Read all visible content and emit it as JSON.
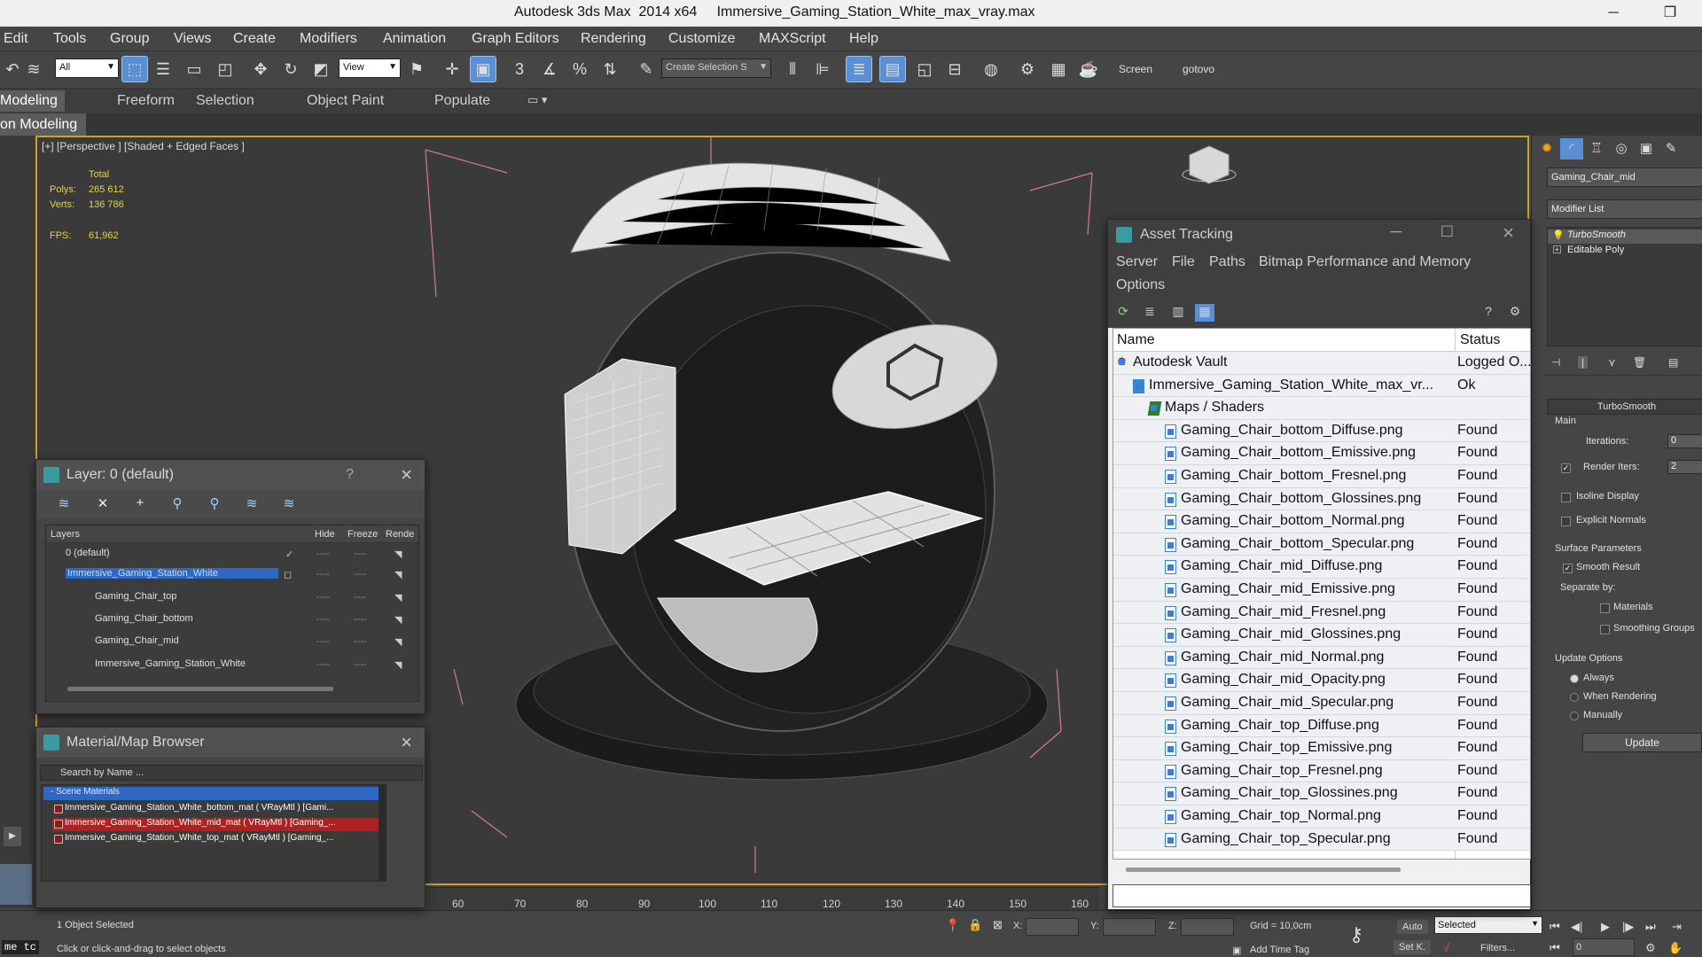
{
  "window": {
    "title": "Autodesk 3ds Max  2014 x64     Immersive_Gaming_Station_White_max_vray.max",
    "minimize": "─",
    "maximize": "❐"
  },
  "menu": [
    "Edit",
    "Tools",
    "Group",
    "Views",
    "Create",
    "Modifiers",
    "Animation",
    "Graph Editors",
    "Rendering",
    "Customize",
    "MAXScript",
    "Help"
  ],
  "toolbar": {
    "filter_value": "All",
    "view_value": "View",
    "selection_set_placeholder": "Create Selection S",
    "screen_label": "Screen",
    "gotovo_label": "gotovo"
  },
  "ribbon": {
    "tabs": [
      "Modeling",
      "Freeform",
      "Selection",
      "Object Paint",
      "Populate"
    ],
    "sub_label": "on Modeling"
  },
  "viewport": {
    "label": "[+] [Perspective ] [Shaded + Edged Faces ]",
    "stats_total": "Total",
    "polys_label": "Polys:",
    "polys_value": "265 612",
    "verts_label": "Verts:",
    "verts_value": "136 786",
    "fps_label": "FPS:",
    "fps_value": "61,962"
  },
  "layer_explorer": {
    "title": "Layer: 0 (default)",
    "help": "?",
    "columns": [
      "Layers",
      "Hide",
      "Freeze",
      "Rende"
    ],
    "rows": [
      {
        "name": "0 (default)",
        "indent": 0
      },
      {
        "name": "Immersive_Gaming_Station_White",
        "indent": 0,
        "selected": true
      },
      {
        "name": "Gaming_Chair_top",
        "indent": 1
      },
      {
        "name": "Gaming_Chair_bottom",
        "indent": 1
      },
      {
        "name": "Gaming_Chair_mid",
        "indent": 1
      },
      {
        "name": "Immersive_Gaming_Station_White",
        "indent": 1
      }
    ],
    "dash": "----"
  },
  "material_browser": {
    "title": "Material/Map Browser",
    "search_placeholder": "Search by Name ...",
    "group": "- Scene Materials",
    "items": [
      "Immersive_Gaming_Station_White_bottom_mat ( VRayMtl ) [Gami...",
      "Immersive_Gaming_Station_White_mid_mat ( VRayMtl ) [Gaming_...",
      "Immersive_Gaming_Station_White_top_mat ( VRayMtl ) [Gaming_..."
    ]
  },
  "asset_tracking": {
    "title": "Asset Tracking",
    "menu": [
      "Server",
      "File",
      "Paths",
      "Bitmap Performance and Memory",
      "Options"
    ],
    "col_name": "Name",
    "col_status": "Status",
    "rows": [
      {
        "name": "Autodesk Vault",
        "status": "Logged O...",
        "level": 0
      },
      {
        "name": "Immersive_Gaming_Station_White_max_vr...",
        "status": "Ok",
        "level": 1
      },
      {
        "name": "Maps / Shaders",
        "status": "",
        "level": 2
      },
      {
        "name": "Gaming_Chair_bottom_Diffuse.png",
        "status": "Found",
        "level": 3
      },
      {
        "name": "Gaming_Chair_bottom_Emissive.png",
        "status": "Found",
        "level": 3
      },
      {
        "name": "Gaming_Chair_bottom_Fresnel.png",
        "status": "Found",
        "level": 3
      },
      {
        "name": "Gaming_Chair_bottom_Glossines.png",
        "status": "Found",
        "level": 3
      },
      {
        "name": "Gaming_Chair_bottom_Normal.png",
        "status": "Found",
        "level": 3
      },
      {
        "name": "Gaming_Chair_bottom_Specular.png",
        "status": "Found",
        "level": 3
      },
      {
        "name": "Gaming_Chair_mid_Diffuse.png",
        "status": "Found",
        "level": 3
      },
      {
        "name": "Gaming_Chair_mid_Emissive.png",
        "status": "Found",
        "level": 3
      },
      {
        "name": "Gaming_Chair_mid_Fresnel.png",
        "status": "Found",
        "level": 3
      },
      {
        "name": "Gaming_Chair_mid_Glossines.png",
        "status": "Found",
        "level": 3
      },
      {
        "name": "Gaming_Chair_mid_Normal.png",
        "status": "Found",
        "level": 3
      },
      {
        "name": "Gaming_Chair_mid_Opacity.png",
        "status": "Found",
        "level": 3
      },
      {
        "name": "Gaming_Chair_mid_Specular.png",
        "status": "Found",
        "level": 3
      },
      {
        "name": "Gaming_Chair_top_Diffuse.png",
        "status": "Found",
        "level": 3
      },
      {
        "name": "Gaming_Chair_top_Emissive.png",
        "status": "Found",
        "level": 3
      },
      {
        "name": "Gaming_Chair_top_Fresnel.png",
        "status": "Found",
        "level": 3
      },
      {
        "name": "Gaming_Chair_top_Glossines.png",
        "status": "Found",
        "level": 3
      },
      {
        "name": "Gaming_Chair_top_Normal.png",
        "status": "Found",
        "level": 3
      },
      {
        "name": "Gaming_Chair_top_Specular.png",
        "status": "Found",
        "level": 3
      }
    ]
  },
  "command_panel": {
    "object_name": "Gaming_Chair_mid",
    "modifier_list": "Modifier List",
    "stack": [
      "TurboSmooth",
      "Editable Poly"
    ],
    "rollout_title": "TurboSmooth",
    "main_label": "Main",
    "iterations_label": "Iterations:",
    "iterations_value": "0",
    "render_iters_label": "Render Iters:",
    "render_iters_value": "2",
    "isoline_label": "Isoline Display",
    "explicit_normals_label": "Explicit Normals",
    "surface_params_label": "Surface Parameters",
    "smooth_result_label": "Smooth Result",
    "separate_by_label": "Separate by:",
    "materials_label": "Materials",
    "smoothing_groups_label": "Smoothing Groups",
    "update_options_label": "Update Options",
    "always_label": "Always",
    "when_rendering_label": "When Rendering",
    "manually_label": "Manually",
    "update_button": "Update"
  },
  "timeline": {
    "ticks": [
      "60",
      "70",
      "80",
      "90",
      "100",
      "110",
      "120",
      "130",
      "140",
      "150",
      "160"
    ]
  },
  "status_bar": {
    "selected_text": "1 Object Selected",
    "prompt_text": "Click or click-and-drag to select objects",
    "script_left": "me  tc",
    "x_label": "X:",
    "y_label": "Y:",
    "z_label": "Z:",
    "grid_text": "Grid = 10,0cm",
    "auto_label": "Auto",
    "selected_combo": "Selected",
    "setk_label": "Set K.",
    "filters_label": "Filters...",
    "add_time_tag": "Add Time Tag",
    "frame_value": "0"
  },
  "colors": {
    "viewport_border": "#c9a227",
    "selection_blue": "#2f67c4",
    "stats_yellow": "#e8d14a",
    "active_button": "#5b8fd4"
  }
}
